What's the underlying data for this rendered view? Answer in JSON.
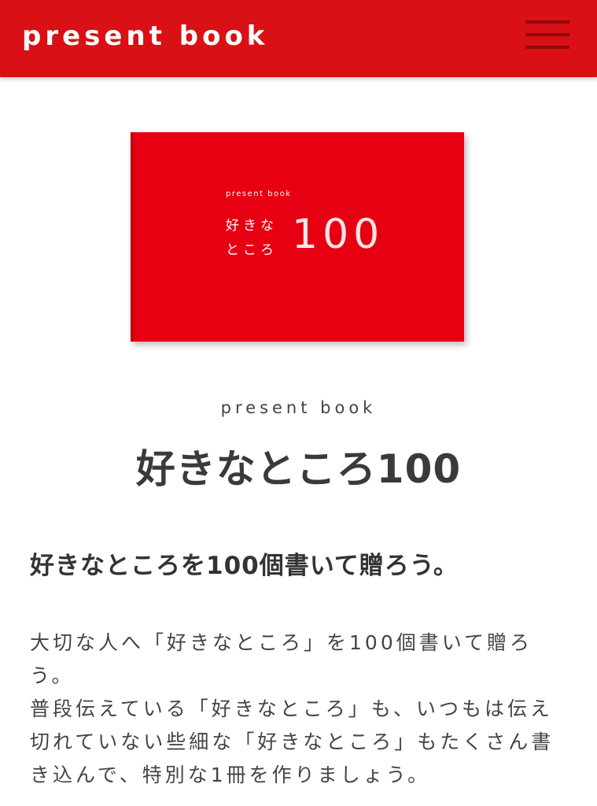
{
  "header": {
    "logo": "present book",
    "bg_color": "#d91015",
    "menu_icon": "hamburger-menu-icon"
  },
  "cover": {
    "color": "#e60012",
    "brand": "present book",
    "title_line1": "好きな",
    "title_line2": "ところ",
    "number": "100"
  },
  "product": {
    "brand": "present book",
    "title": "好きなところ100"
  },
  "lead": "好きなところを100個書いて贈ろう。",
  "description": [
    "大切な人へ「好きなところ」を100個書いて贈ろう。",
    "普段伝えている「好きなところ」も、いつもは伝え切れていない些細な「好きなところ」もたくさん書き込んで、特別な1冊を作りましょう。"
  ]
}
